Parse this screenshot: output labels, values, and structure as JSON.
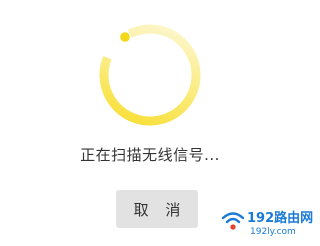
{
  "scan": {
    "status_text": "正在扫描无线信号...",
    "cancel_label": "取 消",
    "spinner_color": "#f8e040"
  },
  "watermark": {
    "brand": "192路由网",
    "domain": "192ly.com",
    "color": "#1a7bd6"
  }
}
